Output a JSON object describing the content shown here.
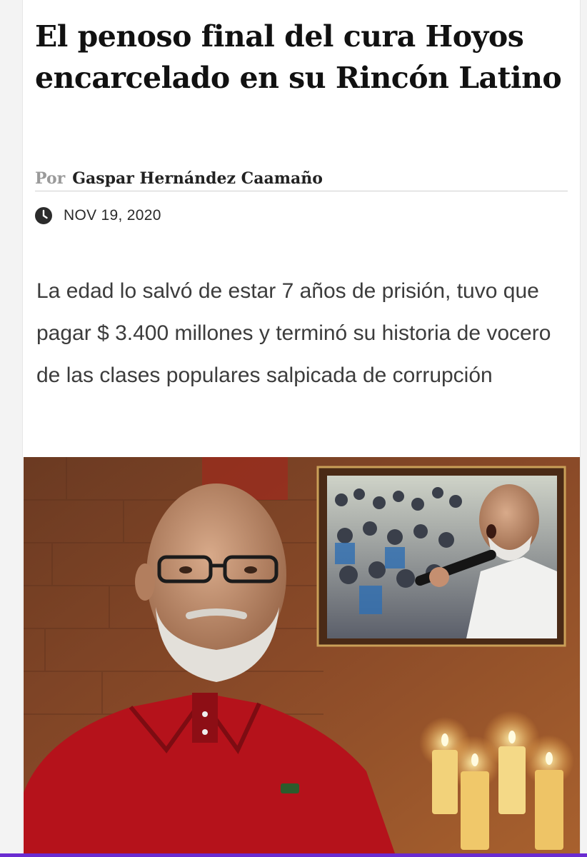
{
  "article": {
    "title": "El penoso final del cura Hoyos encarcelado en su Rincón Latino",
    "byline_prefix": "Por",
    "author": "Gaspar Hernández Caamaño",
    "date": "NOV 19, 2020",
    "excerpt": "La edad lo salvó de estar 7 años de prisión, tuvo que pagar $ 3.400 millones y terminó su historia de vocero de las clases populares salpicada de corrupción"
  },
  "icons": {
    "date_icon": "clock-icon"
  },
  "colors": {
    "title": "#111111",
    "byline_prefix": "#9a9a9a",
    "excerpt": "#3c3c3c",
    "shirt_red": "#b5121b",
    "bottom_accent": "#6a2bd1"
  }
}
